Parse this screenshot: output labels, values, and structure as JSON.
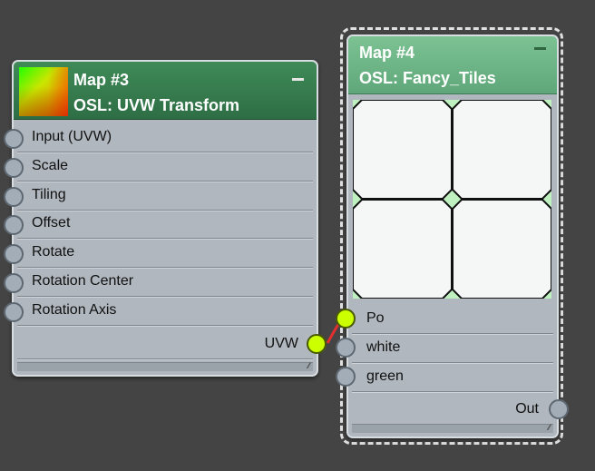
{
  "nodes": {
    "map3": {
      "title": "Map #3",
      "subtitle": "OSL: UVW Transform",
      "inputs": [
        "Input (UVW)",
        "Scale",
        "Tiling",
        "Offset",
        "Rotate",
        "Rotation Center",
        "Rotation Axis"
      ],
      "output": "UVW"
    },
    "map4": {
      "title": "Map #4",
      "subtitle": "OSL: Fancy_Tiles",
      "inputs": [
        "Po",
        "white",
        "green"
      ],
      "output": "Out"
    }
  },
  "colors": {
    "background": "#444444",
    "node_body": "#b0b7be",
    "map3_header": "#2e6e45",
    "map4_header": "#5fa77a",
    "active_socket": "#ccff00",
    "wire": "#e03030",
    "tile_fill": "#f4f7f6",
    "tile_gap": "#bff0bf"
  },
  "icons": {
    "minimize": "minimize-icon",
    "socket": "socket-icon",
    "resize": "resize-grip-icon"
  }
}
